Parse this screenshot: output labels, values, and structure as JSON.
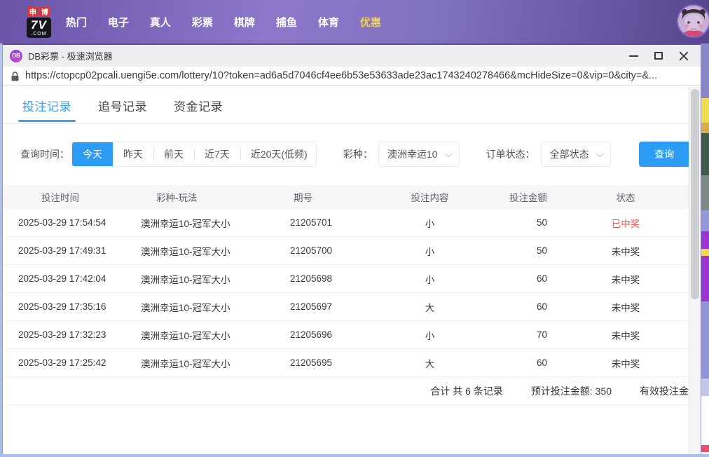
{
  "app_nav": {
    "logo": {
      "badge_left": "申",
      "badge_right": "博",
      "main": "7V",
      "suffix": ".COM"
    },
    "items": [
      {
        "label": "热门",
        "highlight": false
      },
      {
        "label": "电子",
        "highlight": false
      },
      {
        "label": "真人",
        "highlight": false
      },
      {
        "label": "彩票",
        "highlight": false
      },
      {
        "label": "棋牌",
        "highlight": false
      },
      {
        "label": "捕鱼",
        "highlight": false
      },
      {
        "label": "体育",
        "highlight": false
      },
      {
        "label": "优惠",
        "highlight": true
      }
    ]
  },
  "browser": {
    "window_title": "DB彩票 - 极速浏览器",
    "favicon_text": "DB",
    "url": "https://ctopcp02pcali.uengi5e.com/lottery/10?token=ad6a5d7046cf4ee6b53e53633ade23ac1743240278466&mcHideSize=0&vip=0&city=&..."
  },
  "tabs": [
    {
      "label": "投注记录",
      "active": true
    },
    {
      "label": "追号记录",
      "active": false
    },
    {
      "label": "资金记录",
      "active": false
    }
  ],
  "filters": {
    "time_label": "查询时间：",
    "time_options": [
      {
        "label": "今天",
        "active": true
      },
      {
        "label": "昨天",
        "active": false
      },
      {
        "label": "前天",
        "active": false
      },
      {
        "label": "近7天",
        "active": false
      },
      {
        "label": "近20天(低频)",
        "active": false
      }
    ],
    "lottery_label": "彩种：",
    "lottery_value": "澳洲幸运10",
    "status_label": "订单状态：",
    "status_value": "全部状态",
    "search_button": "查询"
  },
  "table": {
    "columns": [
      "投注时间",
      "彩种-玩法",
      "期号",
      "投注内容",
      "投注金额",
      "状态"
    ],
    "rows": [
      {
        "time": "2025-03-29 17:54:54",
        "game": "澳洲幸运10-冠军大小",
        "issue": "21205701",
        "content": "小",
        "amount": "50",
        "status": "已中奖",
        "won": true
      },
      {
        "time": "2025-03-29 17:49:31",
        "game": "澳洲幸运10-冠军大小",
        "issue": "21205700",
        "content": "小",
        "amount": "50",
        "status": "未中奖",
        "won": false
      },
      {
        "time": "2025-03-29 17:42:04",
        "game": "澳洲幸运10-冠军大小",
        "issue": "21205698",
        "content": "小",
        "amount": "60",
        "status": "未中奖",
        "won": false
      },
      {
        "time": "2025-03-29 17:35:16",
        "game": "澳洲幸运10-冠军大小",
        "issue": "21205697",
        "content": "大",
        "amount": "60",
        "status": "未中奖",
        "won": false
      },
      {
        "time": "2025-03-29 17:32:23",
        "game": "澳洲幸运10-冠军大小",
        "issue": "21205696",
        "content": "小",
        "amount": "70",
        "status": "未中奖",
        "won": false
      },
      {
        "time": "2025-03-29 17:25:42",
        "game": "澳洲幸运10-冠军大小",
        "issue": "21205695",
        "content": "大",
        "amount": "60",
        "status": "未中奖",
        "won": false
      }
    ],
    "summary": {
      "total_label": "合计 共 6 条记录",
      "estimated_label": "预计投注金额: 350",
      "valid_label": "有效投注金"
    }
  },
  "colors": {
    "accent_blue": "#2d9cf4",
    "win_red": "#f2544a",
    "nav_highlight": "#f0d24a"
  }
}
